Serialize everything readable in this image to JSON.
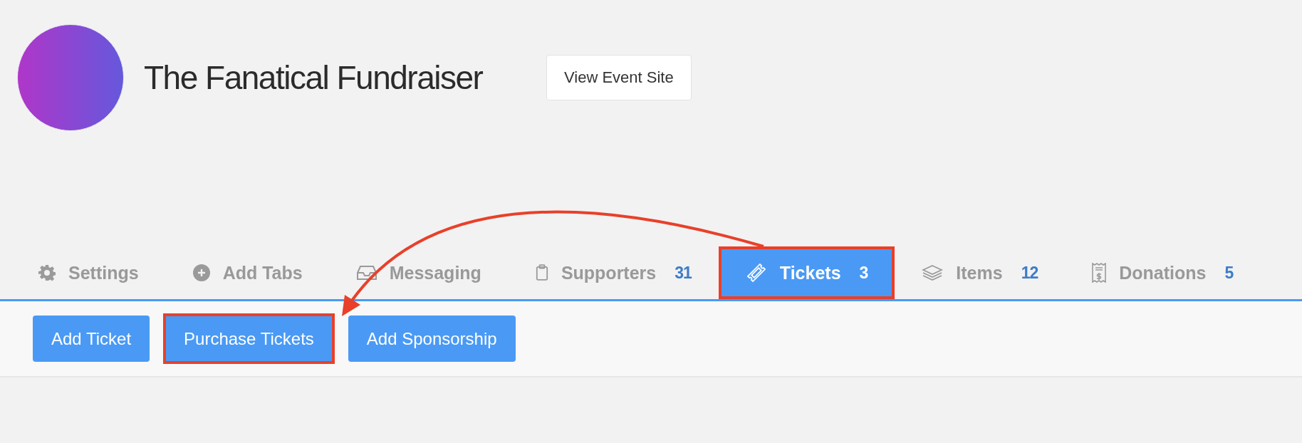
{
  "event": {
    "title": "The Fanatical Fundraiser",
    "view_site_button": "View Event Site"
  },
  "tabs": [
    {
      "label": "Settings",
      "kind": "gear",
      "selected": false,
      "highlighted": false
    },
    {
      "label": "Add Tabs",
      "kind": "plus",
      "selected": false,
      "highlighted": false
    },
    {
      "label": "Messaging",
      "kind": "inbox",
      "selected": false,
      "highlighted": false
    },
    {
      "label": "Supporters",
      "kind": "clipboard",
      "count": "31",
      "selected": false,
      "highlighted": false
    },
    {
      "label": "Tickets",
      "kind": "ticket",
      "count": "3",
      "selected": true,
      "highlighted": true
    },
    {
      "label": "Items",
      "kind": "layers",
      "count": "12",
      "selected": false,
      "highlighted": false
    },
    {
      "label": "Donations",
      "kind": "receipt",
      "count": "5",
      "selected": false,
      "highlighted": false
    }
  ],
  "toolbar": {
    "buttons": [
      {
        "label": "Add Ticket",
        "highlighted": false
      },
      {
        "label": "Purchase Tickets",
        "highlighted": true
      },
      {
        "label": "Add Sponsorship",
        "highlighted": false
      }
    ]
  }
}
